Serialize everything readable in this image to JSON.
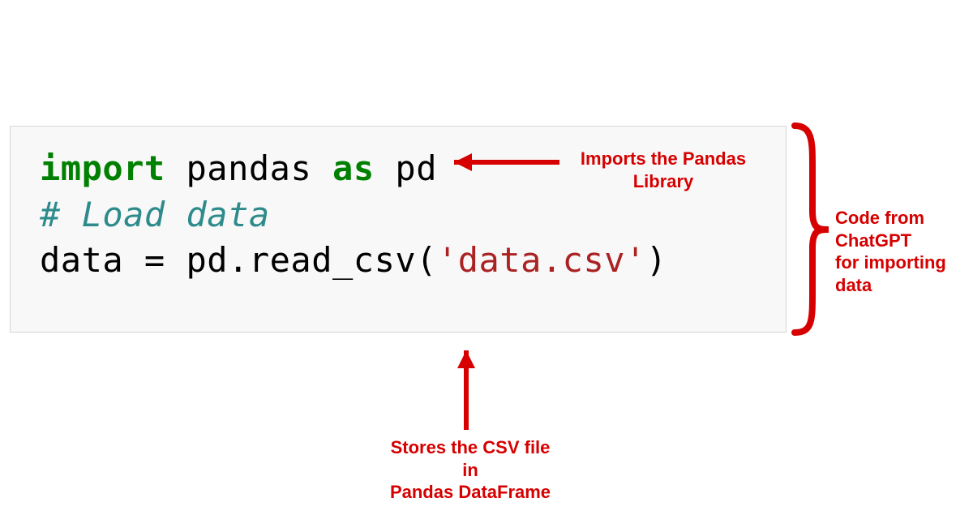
{
  "code": {
    "line1": {
      "kw_import": "import",
      "sp1": " ",
      "pandas": "pandas",
      "sp2": " ",
      "kw_as": "as",
      "sp3": " ",
      "alias": "pd"
    },
    "line2": "",
    "line3": "# Load data",
    "line4": {
      "lhs": "data = pd.read_csv(",
      "q1": "'",
      "fname": "data.csv",
      "q2": "'",
      "rparen": ")"
    }
  },
  "annotations": {
    "top": "Imports the Pandas\nLibrary",
    "right": "Code from ChatGPT\nfor importing data",
    "bottom": "Stores the CSV file in\nPandas DataFrame"
  },
  "colors": {
    "annotation": "#d60000"
  }
}
